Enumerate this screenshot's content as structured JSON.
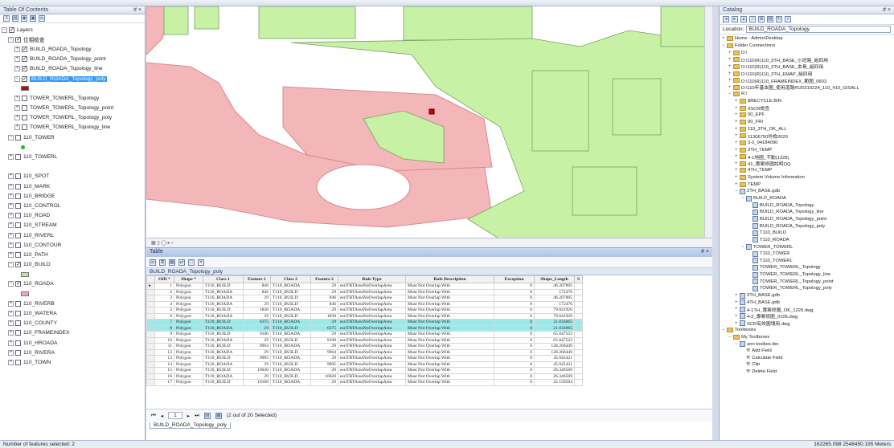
{
  "toc": {
    "title": "Table Of Contents",
    "pin": "# ×",
    "layers": [
      {
        "label": "Layers",
        "exp": "⊟",
        "chk": "on",
        "indent": 0
      },
      {
        "label": "位相檢查",
        "exp": "⊟",
        "chk": "on",
        "indent": 1
      },
      {
        "label": "BUILD_ROADA_Topology",
        "exp": "⊞",
        "chk": "on",
        "indent": 2
      },
      {
        "label": "BUILD_ROADA_Topology_point",
        "exp": "⊞",
        "chk": "on",
        "indent": 2
      },
      {
        "label": "BUILD_ROADA_Topology_line",
        "exp": "⊞",
        "chk": "on",
        "indent": 2
      },
      {
        "label": "BUILD_ROADA_Topology_poly",
        "exp": "⊟",
        "chk": "on",
        "indent": 2,
        "selected": true
      },
      {
        "label": "",
        "swatch": "#d40000",
        "indent": 3
      },
      {
        "label": "TOWER_TOWERL_Topology",
        "exp": "⊞",
        "chk": "off",
        "indent": 2
      },
      {
        "label": "TOWER_TOWERL_Topology_point",
        "exp": "⊞",
        "chk": "off",
        "indent": 2
      },
      {
        "label": "TOWER_TOWERL_Topology_poly",
        "exp": "⊞",
        "chk": "off",
        "indent": 2
      },
      {
        "label": "TOWER_TOWERL_Topology_line",
        "exp": "⊞",
        "chk": "off",
        "indent": 2
      },
      {
        "label": "110_TOWER",
        "exp": "⊟",
        "chk": "off",
        "indent": 1
      },
      {
        "label": "",
        "dot": "#22bb22",
        "indent": 3
      },
      {
        "label": "110_TOWERL",
        "exp": "⊞",
        "chk": "off",
        "indent": 1
      },
      {
        "label": "",
        "indent": 1
      },
      {
        "label": "110_SPOT",
        "exp": "⊞",
        "chk": "off",
        "indent": 1
      },
      {
        "label": "110_MARK",
        "exp": "⊞",
        "chk": "off",
        "indent": 1
      },
      {
        "label": "110_BRIDGE",
        "exp": "⊞",
        "chk": "off",
        "indent": 1
      },
      {
        "label": "110_CONTROL",
        "exp": "⊞",
        "chk": "off",
        "indent": 1
      },
      {
        "label": "110_ROAD",
        "exp": "⊞",
        "chk": "off",
        "indent": 1
      },
      {
        "label": "110_STREAM",
        "exp": "⊞",
        "chk": "off",
        "indent": 1
      },
      {
        "label": "110_RIVERL",
        "exp": "⊞",
        "chk": "off",
        "indent": 1
      },
      {
        "label": "110_CONTOUR",
        "exp": "⊞",
        "chk": "off",
        "indent": 1
      },
      {
        "label": "110_PATH",
        "exp": "⊞",
        "chk": "off",
        "indent": 1
      },
      {
        "label": "110_BUILD",
        "exp": "⊟",
        "chk": "on",
        "indent": 1
      },
      {
        "label": "",
        "swatch": "#b6ea96",
        "indent": 3
      },
      {
        "label": "110_ROADA",
        "exp": "⊟",
        "chk": "on",
        "indent": 1
      },
      {
        "label": "",
        "swatch": "#f2a8ac",
        "indent": 3
      },
      {
        "label": "110_RIVERB",
        "exp": "⊞",
        "chk": "off",
        "indent": 1
      },
      {
        "label": "110_WATERA",
        "exp": "⊞",
        "chk": "off",
        "indent": 1
      },
      {
        "label": "110_COUNTY",
        "exp": "⊞",
        "chk": "off",
        "indent": 1
      },
      {
        "label": "110_FRAMEINDEX",
        "exp": "⊞",
        "chk": "off",
        "indent": 1
      },
      {
        "label": "110_HROADA",
        "exp": "⊞",
        "chk": "off",
        "indent": 1
      },
      {
        "label": "110_RIVERA",
        "exp": "⊞",
        "chk": "off",
        "indent": 1
      },
      {
        "label": "110_TOWN",
        "exp": "⊞",
        "chk": "off",
        "indent": 1
      }
    ]
  },
  "map": {
    "colors": {
      "road": "#f4b7b9",
      "road_stroke": "#d98a8f",
      "build": "#c7f2a6",
      "build_stroke": "#7aa060"
    }
  },
  "table": {
    "title": "Table",
    "pin": "# ×",
    "sheet_name": "BUILD_ROADA_Topology_poly",
    "columns": [
      "OID *",
      "Shape *",
      "Class 1",
      "Feature 1",
      "Class 2",
      "Feature 2",
      "Rule Type",
      "Rule Description",
      "Exception",
      "Shape_Length",
      "S"
    ],
    "rows": [
      [
        "1",
        "Polygon",
        "T110_BUILD",
        "846",
        "T110_ROADA",
        "29",
        "esriTRTAreaNoOverlapArea",
        "Must Not Overlap With",
        "0",
        "46.207895",
        ""
      ],
      [
        "2",
        "Polygon",
        "T110_ROADA",
        "846",
        "T110_BUILD",
        "29",
        "esriTRTAreaNoOverlapArea",
        "Must Not Overlap With",
        "0",
        "172476",
        ""
      ],
      [
        "3",
        "Polygon",
        "T110_ROADA",
        "29",
        "T110_BUILD",
        "846",
        "esriTRTAreaNoOverlapArea",
        "Must Not Overlap With",
        "0",
        "46.207895",
        ""
      ],
      [
        "4",
        "Polygon",
        "T110_ROADA",
        "29",
        "T110_BUILD",
        "846",
        "esriTRTAreaNoOverlapArea",
        "Must Not Overlap With",
        "0",
        "172476",
        ""
      ],
      [
        "5",
        "Polygon",
        "T110_BUILD",
        "1830",
        "T110_ROADA",
        "29",
        "esriTRTAreaNoOverlapArea",
        "Must Not Overlap With",
        "0",
        "79.041926",
        ""
      ],
      [
        "6",
        "Polygon",
        "T110_ROADA",
        "29",
        "T110_BUILD",
        "1830",
        "esriTRTAreaNoOverlapArea",
        "Must Not Overlap With",
        "0",
        "79.041926",
        ""
      ],
      [
        "7",
        "Polygon",
        "T110_BUILD",
        "6375",
        "T110_ROADA",
        "29",
        "esriTRTAreaNoOverlapArea",
        "Must Not Overlap With",
        "0",
        "21.033065",
        ""
      ],
      [
        "8",
        "Polygon",
        "T110_ROADA",
        "29",
        "T110_BUILD",
        "6375",
        "esriTRTAreaNoOverlapArea",
        "Must Not Overlap With",
        "0",
        "21.033065",
        ""
      ],
      [
        "9",
        "Polygon",
        "T110_BUILD",
        "9100",
        "T110_ROADA",
        "29",
        "esriTRTAreaNoOverlapArea",
        "Must Not Overlap With",
        "0",
        "65.047522",
        ""
      ],
      [
        "10",
        "Polygon",
        "T110_ROADA",
        "29",
        "T110_BUILD",
        "9100",
        "esriTRTAreaNoOverlapArea",
        "Must Not Overlap With",
        "0",
        "65.047522",
        ""
      ],
      [
        "11",
        "Polygon",
        "T110_BUILD",
        "9964",
        "T110_ROADA",
        "29",
        "esriTRTAreaNoOverlapArea",
        "Must Not Overlap With",
        "0",
        "128.260449",
        ""
      ],
      [
        "12",
        "Polygon",
        "T110_ROADA",
        "29",
        "T110_BUILD",
        "9964",
        "esriTRTAreaNoOverlapArea",
        "Must Not Overlap With",
        "0",
        "128.260449",
        ""
      ],
      [
        "13",
        "Polygon",
        "T110_BUILD",
        "9995",
        "T110_ROADA",
        "29",
        "esriTRTAreaNoOverlapArea",
        "Must Not Overlap With",
        "0",
        "45.945421",
        ""
      ],
      [
        "14",
        "Polygon",
        "T110_ROADA",
        "29",
        "T110_BUILD",
        "9995",
        "esriTRTAreaNoOverlapArea",
        "Must Not Overlap With",
        "0",
        "45.945421",
        ""
      ],
      [
        "15",
        "Polygon",
        "T110_BUILD",
        "16020",
        "T110_ROADA",
        "29",
        "esriTRTAreaNoOverlapArea",
        "Must Not Overlap With",
        "0",
        "26.346569",
        ""
      ],
      [
        "16",
        "Polygon",
        "T110_ROADA",
        "29",
        "T110_BUILD",
        "16020",
        "esriTRTAreaNoOverlapArea",
        "Must Not Overlap With",
        "0",
        "26.346569",
        ""
      ],
      [
        "17",
        "Polygon",
        "T110_BUILD",
        "19100",
        "T110_ROADA",
        "29",
        "esriTRTAreaNoOverlapArea",
        "Must Not Overlap With",
        "0",
        "22.150594",
        ""
      ]
    ],
    "highlight_rows": [
      6,
      7
    ],
    "footer": {
      "page": "1",
      "selected_text": "(2 out of 20 Selected)"
    },
    "bottom_tab": "BUILD_ROADA_Topology_poly"
  },
  "catalog": {
    "title": "Catalog",
    "pin": "# ×",
    "location_label": "Location:",
    "location_value": "BUILD_ROADA_Topology",
    "items": [
      {
        "label": "Home - Admin\\Desktop",
        "icon": "folder",
        "indent": 0,
        "exp": "⊞"
      },
      {
        "label": "Folder Connections",
        "icon": "folder",
        "indent": 0,
        "exp": "⊟"
      },
      {
        "label": "D:\\",
        "icon": "folder",
        "indent": 1,
        "exp": "⊞"
      },
      {
        "label": "D:\\110(R)110_3TH_BASE_小班路_組四用",
        "icon": "folder",
        "indent": 1,
        "exp": "⊞"
      },
      {
        "label": "D:\\110(R)110_3TH_BASE_本島_組四用",
        "icon": "folder",
        "indent": 1,
        "exp": "⊞"
      },
      {
        "label": "D:\\110(R)110_3TH_EMAP_組四用",
        "icon": "folder",
        "indent": 1,
        "exp": "⊞"
      },
      {
        "label": "D:\\110(R)110_FRAMEINDEX_範圍_0603",
        "icon": "folder",
        "indent": 1,
        "exp": "⊞"
      },
      {
        "label": "D:\\110年基本圖_使用道路R\\20210224_110_410_GISALL",
        "icon": "folder",
        "indent": 1,
        "exp": "⊞"
      },
      {
        "label": "R:\\",
        "icon": "folder",
        "indent": 1,
        "exp": "⊟"
      },
      {
        "label": "$RECYCLE.BIN",
        "icon": "folder",
        "indent": 2,
        "exp": "⊞"
      },
      {
        "label": "0SCR檢查",
        "icon": "folder",
        "indent": 2,
        "exp": "⊞"
      },
      {
        "label": "00_EPF",
        "icon": "folder",
        "indent": 2,
        "exp": "⊞"
      },
      {
        "label": "00_FRI",
        "icon": "folder",
        "indent": 2,
        "exp": "⊞"
      },
      {
        "label": "110_3TH_OK_ALL",
        "icon": "folder",
        "indent": 2,
        "exp": "⊞"
      },
      {
        "label": "11306750件檢2020",
        "icon": "folder",
        "indent": 2,
        "exp": "⊞"
      },
      {
        "label": "3-2_94184090",
        "icon": "folder",
        "indent": 2,
        "exp": "⊞"
      },
      {
        "label": "3TH_TEMP",
        "icon": "folder",
        "indent": 2,
        "exp": "⊞"
      },
      {
        "label": "4-1地圖_不動(1228)",
        "icon": "folder",
        "indent": 2,
        "exp": "⊞"
      },
      {
        "label": "41_專案修圖說明QQ",
        "icon": "folder",
        "indent": 2,
        "exp": "⊞"
      },
      {
        "label": "4TH_TEMP",
        "icon": "folder",
        "indent": 2,
        "exp": "⊞"
      },
      {
        "label": "System Volume Information",
        "icon": "folder",
        "indent": 2,
        "exp": "⊞"
      },
      {
        "label": "TEMP",
        "icon": "folder",
        "indent": 2,
        "exp": "⊞"
      },
      {
        "label": "2TH_BASE.gdb",
        "icon": "db",
        "indent": 2,
        "exp": "⊟"
      },
      {
        "label": "BUILD_ROADA",
        "icon": "db",
        "indent": 3,
        "exp": "⊟"
      },
      {
        "label": "BUILD_ROADA_Topology",
        "icon": "db",
        "indent": 4,
        "exp": ""
      },
      {
        "label": "BUILD_ROADA_Topology_line",
        "icon": "db",
        "indent": 4,
        "exp": ""
      },
      {
        "label": "BUILD_ROADA_Topology_point",
        "icon": "db",
        "indent": 4,
        "exp": ""
      },
      {
        "label": "BUILD_ROADA_Topology_poly",
        "icon": "db",
        "indent": 4,
        "exp": ""
      },
      {
        "label": "T110_BUILD",
        "icon": "db",
        "indent": 4,
        "exp": ""
      },
      {
        "label": "T110_ROADA",
        "icon": "db",
        "indent": 4,
        "exp": ""
      },
      {
        "label": "TOWER_TOWERL",
        "icon": "db",
        "indent": 3,
        "exp": "⊟"
      },
      {
        "label": "T110_TOWER",
        "icon": "db",
        "indent": 4,
        "exp": ""
      },
      {
        "label": "T110_TOWERL",
        "icon": "db",
        "indent": 4,
        "exp": ""
      },
      {
        "label": "TOWER_TOWERL_Topology",
        "icon": "db",
        "indent": 4,
        "exp": ""
      },
      {
        "label": "TOWER_TOWERL_Topology_line",
        "icon": "db",
        "indent": 4,
        "exp": ""
      },
      {
        "label": "TOWER_TOWERL_Topology_point",
        "icon": "db",
        "indent": 4,
        "exp": ""
      },
      {
        "label": "TOWER_TOWERL_Topology_poly",
        "icon": "db",
        "indent": 4,
        "exp": ""
      },
      {
        "label": "3TH_BASE.gdb",
        "icon": "db",
        "indent": 2,
        "exp": "⊞"
      },
      {
        "label": "4TH_BASE.gdb",
        "icon": "db",
        "indent": 2,
        "exp": "⊞"
      },
      {
        "label": "4-1TH_專案修圖_OK_1229.dwg",
        "icon": "db",
        "indent": 2,
        "exp": "⊞"
      },
      {
        "label": "4-2_專案修圖_0105.dwg",
        "icon": "db",
        "indent": 2,
        "exp": "⊞"
      },
      {
        "label": "SCR有效圖塊用.dwg",
        "icon": "db",
        "indent": 2,
        "exp": "⊞"
      },
      {
        "label": "Toolboxes",
        "icon": "folder",
        "indent": 0,
        "exp": "⊟"
      },
      {
        "label": "My Toolboxes",
        "icon": "folder",
        "indent": 1,
        "exp": "⊟"
      },
      {
        "label": "ann toolbox.tbx",
        "icon": "db",
        "indent": 2,
        "exp": "⊟"
      },
      {
        "label": "Add Field",
        "icon": "tool",
        "indent": 3,
        "exp": ""
      },
      {
        "label": "Calculate Field",
        "icon": "tool",
        "indent": 3,
        "exp": ""
      },
      {
        "label": "Clip",
        "icon": "tool",
        "indent": 3,
        "exp": ""
      },
      {
        "label": "Delete Field",
        "icon": "tool",
        "indent": 3,
        "exp": ""
      }
    ]
  },
  "status": {
    "left": "Number of features selected: 2",
    "right": "162265.098  2548450.195 Meters"
  }
}
